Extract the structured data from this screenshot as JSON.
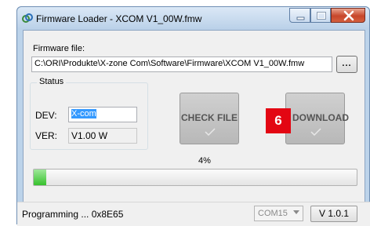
{
  "window": {
    "title": "Firmware Loader - XCOM V1_00W.fmw",
    "controls": [
      "minimize-icon",
      "maximize-icon",
      "close-icon"
    ]
  },
  "firmware": {
    "label": "Firmware file:",
    "path": "C:\\ORI\\Produkte\\X-zone Com\\Software\\Firmware\\XCOM V1_00W.fmw",
    "browse_label": "..."
  },
  "status": {
    "legend": "Status",
    "dev_label": "DEV:",
    "dev_value": "X-com",
    "ver_label": "VER:",
    "ver_value": "V1.00 W"
  },
  "buttons": {
    "check_file": "CHECK FILE",
    "download": "DOWNLOAD"
  },
  "badge": "6",
  "progress": {
    "label": "4%",
    "value": 0.04
  },
  "statusbar": {
    "text": "Programming ... 0x8E65",
    "com_port": "COM15",
    "version": "V 1.0.1"
  },
  "colors": {
    "badge": "#e30613",
    "progress": "#37c12d",
    "selection": "#3399ff"
  }
}
